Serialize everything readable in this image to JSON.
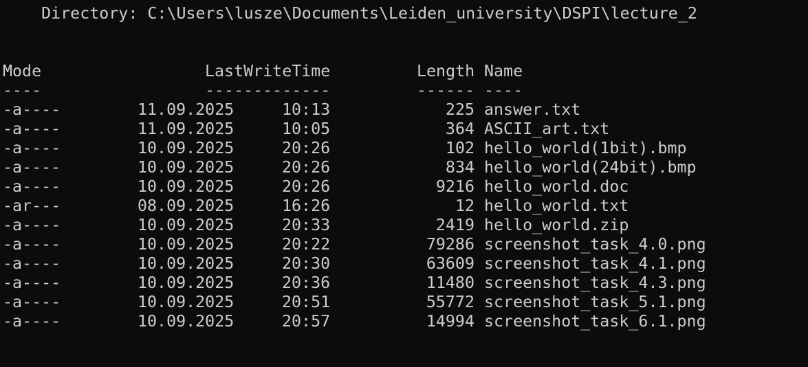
{
  "directory_line": "    Directory: C:\\Users\\lusze\\Documents\\Leiden_university\\DSPI\\lecture_2",
  "headers": {
    "mode": "Mode",
    "last_write_time": "LastWriteTime",
    "length": "Length",
    "name": "Name"
  },
  "underlines": {
    "mode": "----",
    "last_write_time": "-------------",
    "length": "------",
    "name": "----"
  },
  "rows": [
    {
      "mode": "-a----",
      "date": "11.09.2025",
      "time": "10:13",
      "length": "225",
      "name": "answer.txt"
    },
    {
      "mode": "-a----",
      "date": "11.09.2025",
      "time": "10:05",
      "length": "364",
      "name": "ASCII_art.txt"
    },
    {
      "mode": "-a----",
      "date": "10.09.2025",
      "time": "20:26",
      "length": "102",
      "name": "hello_world(1bit).bmp"
    },
    {
      "mode": "-a----",
      "date": "10.09.2025",
      "time": "20:26",
      "length": "834",
      "name": "hello_world(24bit).bmp"
    },
    {
      "mode": "-a----",
      "date": "10.09.2025",
      "time": "20:26",
      "length": "9216",
      "name": "hello_world.doc"
    },
    {
      "mode": "-ar---",
      "date": "08.09.2025",
      "time": "16:26",
      "length": "12",
      "name": "hello_world.txt"
    },
    {
      "mode": "-a----",
      "date": "10.09.2025",
      "time": "20:33",
      "length": "2419",
      "name": "hello_world.zip"
    },
    {
      "mode": "-a----",
      "date": "10.09.2025",
      "time": "20:22",
      "length": "79286",
      "name": "screenshot_task_4.0.png"
    },
    {
      "mode": "-a----",
      "date": "10.09.2025",
      "time": "20:30",
      "length": "63609",
      "name": "screenshot_task_4.1.png"
    },
    {
      "mode": "-a----",
      "date": "10.09.2025",
      "time": "20:36",
      "length": "11480",
      "name": "screenshot_task_4.3.png"
    },
    {
      "mode": "-a----",
      "date": "10.09.2025",
      "time": "20:51",
      "length": "55772",
      "name": "screenshot_task_5.1.png"
    },
    {
      "mode": "-a----",
      "date": "10.09.2025",
      "time": "20:57",
      "length": "14994",
      "name": "screenshot_task_6.1.png"
    }
  ],
  "colors": {
    "background": "#0c0c0c",
    "foreground": "#cccccc"
  }
}
